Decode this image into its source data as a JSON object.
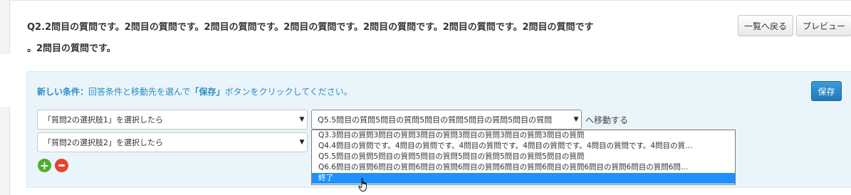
{
  "question": {
    "line1": "Q2.2問目の質問です。2問目の質問です。2問目の質問です。2問目の質問です。2問目の質問です。2問目の質問です。2問目の質問です",
    "line2": "。2問目の質問です。"
  },
  "header": {
    "back_label": "一覧へ戻る",
    "preview_label": "プレビュー"
  },
  "panel": {
    "instruction_strong": "新しい条件：",
    "instruction_text1": "回答条件と移動先を選んで",
    "instruction_bold_save": "「保存」",
    "instruction_text2": "ボタンをクリックしてください。",
    "save_label": "保存",
    "conditions": [
      "「質問2の選択肢1」を選択したら",
      "「質問2の選択肢2」を選択したら"
    ],
    "destination_value": "Q5.5問目の質問5問目の質問5問目の質問5問目の質問5問目の質問",
    "move_label": "へ移動する",
    "dropdown_options": [
      "Q3.3問目の質問3問目の質問3問目の質問3問目の質問3問目の質問3問目の質問",
      "Q4.4問目の質問です。4問目の質問です。4問目の質問です。4問目の質問です。4問目の質問です。4問目の質…",
      "Q5.5問目の質問5問目の質問5問目の質問5問目の質問5問目の質問5問目の質問",
      "Q6.6問目の質問6問目の質問6問目の質問6問目の質問6問目の質問6問目の質問6問目の質問6問目の質問6問…",
      "終了"
    ],
    "selected_option_index": 4
  },
  "colors": {
    "accent": "#2b8dc3",
    "panel_bg": "#eaf4fb",
    "selected_bg": "#1e90ff",
    "add": "#4caf2e",
    "remove": "#e8422b"
  },
  "icons": {
    "add": "plus-circle-icon",
    "remove": "minus-circle-icon",
    "cursor": "hand-pointer-icon"
  }
}
